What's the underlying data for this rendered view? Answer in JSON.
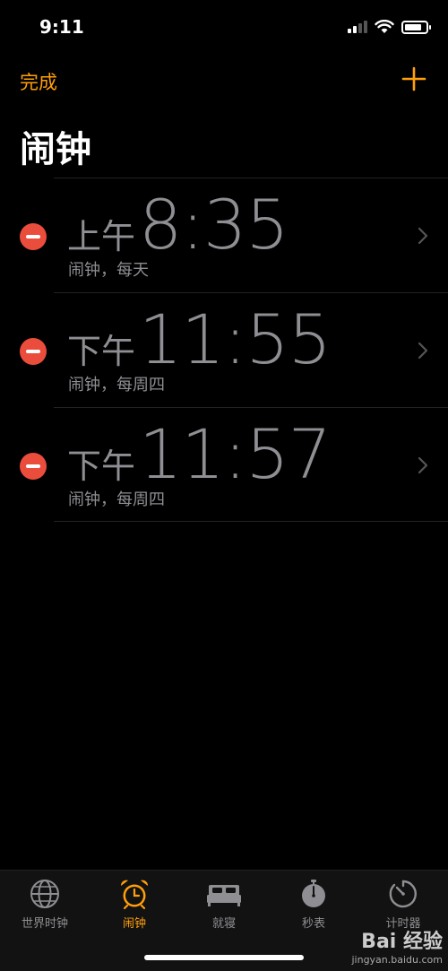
{
  "status_bar": {
    "time": "9:11"
  },
  "nav": {
    "done_label": "完成",
    "add_icon": "plus-icon"
  },
  "page_title": "闹钟",
  "alarms": [
    {
      "period": "上午",
      "time": "8:35",
      "label": "闹钟，每天"
    },
    {
      "period": "下午",
      "time": "11:55",
      "label": "闹钟，每周四"
    },
    {
      "period": "下午",
      "time": "11:57",
      "label": "闹钟，每周四"
    }
  ],
  "tabs": [
    {
      "label": "世界时钟",
      "icon": "globe-icon"
    },
    {
      "label": "闹钟",
      "icon": "alarm-clock-icon",
      "active": true
    },
    {
      "label": "就寝",
      "icon": "bed-icon"
    },
    {
      "label": "秒表",
      "icon": "stopwatch-icon"
    },
    {
      "label": "计时器",
      "icon": "timer-icon"
    }
  ],
  "watermark": {
    "logo": "Bai 经验",
    "url": "jingyan.baidu.com"
  },
  "colors": {
    "accent": "#FF9F0A",
    "delete": "#EB4D3D",
    "text_dim": "#8E8E93",
    "background": "#000000"
  }
}
